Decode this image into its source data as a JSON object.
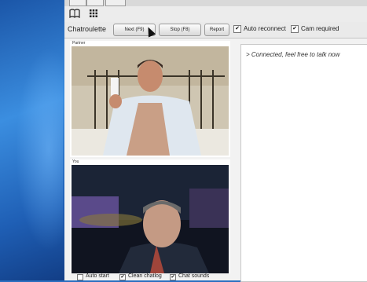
{
  "app": {
    "name": "Chatroulette"
  },
  "toolbar": {
    "next_label": "Next (F9)",
    "stop_label": "Stop (F8)",
    "report_label": "Report",
    "auto_reconnect_label": "Auto reconnect",
    "auto_reconnect_checked": "✔",
    "cam_required_label": "Cam required",
    "cam_required_checked": "✔"
  },
  "iconbar": {
    "book_icon": "book-icon",
    "grid_icon": "grid-icon"
  },
  "partner": {
    "label": "Partner"
  },
  "you": {
    "label": "You"
  },
  "chat": {
    "messages": [
      "> Connected, feel free to talk now"
    ]
  },
  "options": {
    "auto_start_label": "Auto start",
    "auto_start_checked": "",
    "clean_chatlog_label": "Clean chatlog",
    "clean_chatlog_checked": "✔",
    "chat_sounds_label": "Chat sounds",
    "chat_sounds_checked": "✔"
  },
  "colors": {
    "desktop_blue": "#2a6fc0",
    "toolbar_bg": "#eaeaea",
    "panel_bg": "#ffffff"
  }
}
